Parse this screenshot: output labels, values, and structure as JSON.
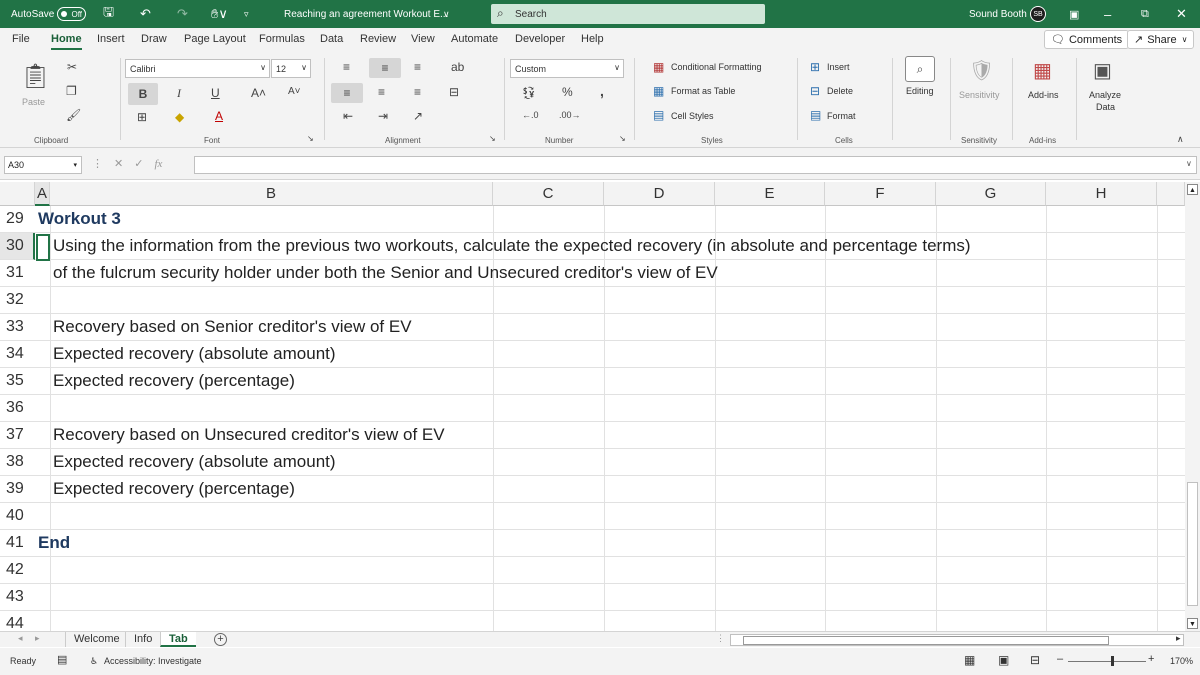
{
  "titlebar": {
    "autosave_label": "AutoSave",
    "autosave_state": "Off",
    "doc_title": "Reaching an agreement Workout E...",
    "search_placeholder": "Search",
    "user_name": "Sound Booth",
    "user_initials": "SB"
  },
  "menu": {
    "items": [
      "File",
      "Home",
      "Insert",
      "Draw",
      "Page Layout",
      "Formulas",
      "Data",
      "Review",
      "View",
      "Automate",
      "Developer",
      "Help"
    ],
    "active": "Home",
    "comments_label": "Comments",
    "share_label": "Share"
  },
  "ribbon": {
    "clipboard": {
      "label": "Clipboard",
      "paste": "Paste"
    },
    "font": {
      "label": "Font",
      "name": "Calibri",
      "size": "12",
      "bold": "B",
      "italic": "I",
      "underline": "U"
    },
    "alignment": {
      "label": "Alignment"
    },
    "number": {
      "label": "Number",
      "format": "Custom",
      "percent": "%",
      "comma": ","
    },
    "styles": {
      "label": "Styles",
      "conditional": "Conditional Formatting",
      "table": "Format as Table",
      "cell": "Cell Styles"
    },
    "cells": {
      "label": "Cells",
      "insert": "Insert",
      "delete": "Delete",
      "format": "Format"
    },
    "editing": {
      "label": "Editing"
    },
    "sensitivity": {
      "label": "Sensitivity",
      "button": "Sensitivity"
    },
    "addins": {
      "label": "Add-ins",
      "button": "Add-ins"
    },
    "analyze": {
      "line1": "Analyze",
      "line2": "Data"
    }
  },
  "formula_bar": {
    "name_box": "A30",
    "fx": "fx",
    "content": ""
  },
  "grid": {
    "columns": [
      "A",
      "B",
      "C",
      "D",
      "E",
      "F",
      "G",
      "H"
    ],
    "rows": [
      {
        "num": "29",
        "text": "Workout 3",
        "style": "bold"
      },
      {
        "num": "30",
        "text": "Using the information from the previous two workouts, calculate the expected recovery (in absolute and percentage terms)",
        "style": "ind"
      },
      {
        "num": "31",
        "text": "of the fulcrum security holder under both the Senior and Unsecured creditor's view of EV",
        "style": "ind"
      },
      {
        "num": "32",
        "text": "",
        "style": ""
      },
      {
        "num": "33",
        "text": "Recovery based on Senior creditor's view of EV",
        "style": "ind"
      },
      {
        "num": "34",
        "text": "Expected recovery (absolute amount)",
        "style": "ind"
      },
      {
        "num": "35",
        "text": "Expected recovery (percentage)",
        "style": "ind"
      },
      {
        "num": "36",
        "text": "",
        "style": ""
      },
      {
        "num": "37",
        "text": "Recovery based on Unsecured creditor's view of EV",
        "style": "ind"
      },
      {
        "num": "38",
        "text": "Expected recovery (absolute amount)",
        "style": "ind"
      },
      {
        "num": "39",
        "text": "Expected recovery (percentage)",
        "style": "ind"
      },
      {
        "num": "40",
        "text": "",
        "style": ""
      },
      {
        "num": "41",
        "text": "End",
        "style": "bold"
      },
      {
        "num": "42",
        "text": "",
        "style": ""
      },
      {
        "num": "43",
        "text": "",
        "style": ""
      },
      {
        "num": "44",
        "text": "",
        "style": ""
      }
    ],
    "selected_row": "30"
  },
  "sheets": {
    "tabs": [
      "Welcome",
      "Info",
      "Tab"
    ],
    "active": "Tab"
  },
  "status": {
    "ready": "Ready",
    "accessibility": "Accessibility: Investigate",
    "zoom": "170%"
  },
  "colors": {
    "accent": "#217346",
    "title_text": "#1f3a60"
  }
}
